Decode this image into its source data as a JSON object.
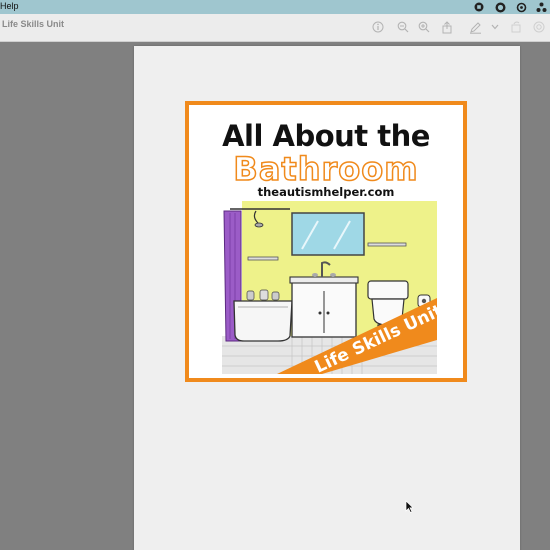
{
  "menubar": {
    "menu_label": "Help",
    "status_icons": [
      "stop-record-icon",
      "messages-icon",
      "sync-icon",
      "share-icon"
    ]
  },
  "toolbar": {
    "document_title": "Life Skills Unit",
    "buttons": [
      "info-icon",
      "zoom-out-icon",
      "zoom-in-icon",
      "share-icon",
      "markup-icon",
      "chevron-down-icon",
      "rotate-icon",
      "search-icon"
    ]
  },
  "cover": {
    "title_line1": "All About the",
    "title_line2": "Bathroom",
    "website": "theautismhelper.com",
    "banner": "Life Skills Unit"
  },
  "colors": {
    "accent": "#f08a1c",
    "wall": "#eef28a",
    "menubar": "#9fc6cf",
    "curtain": "#9b5cc7"
  }
}
